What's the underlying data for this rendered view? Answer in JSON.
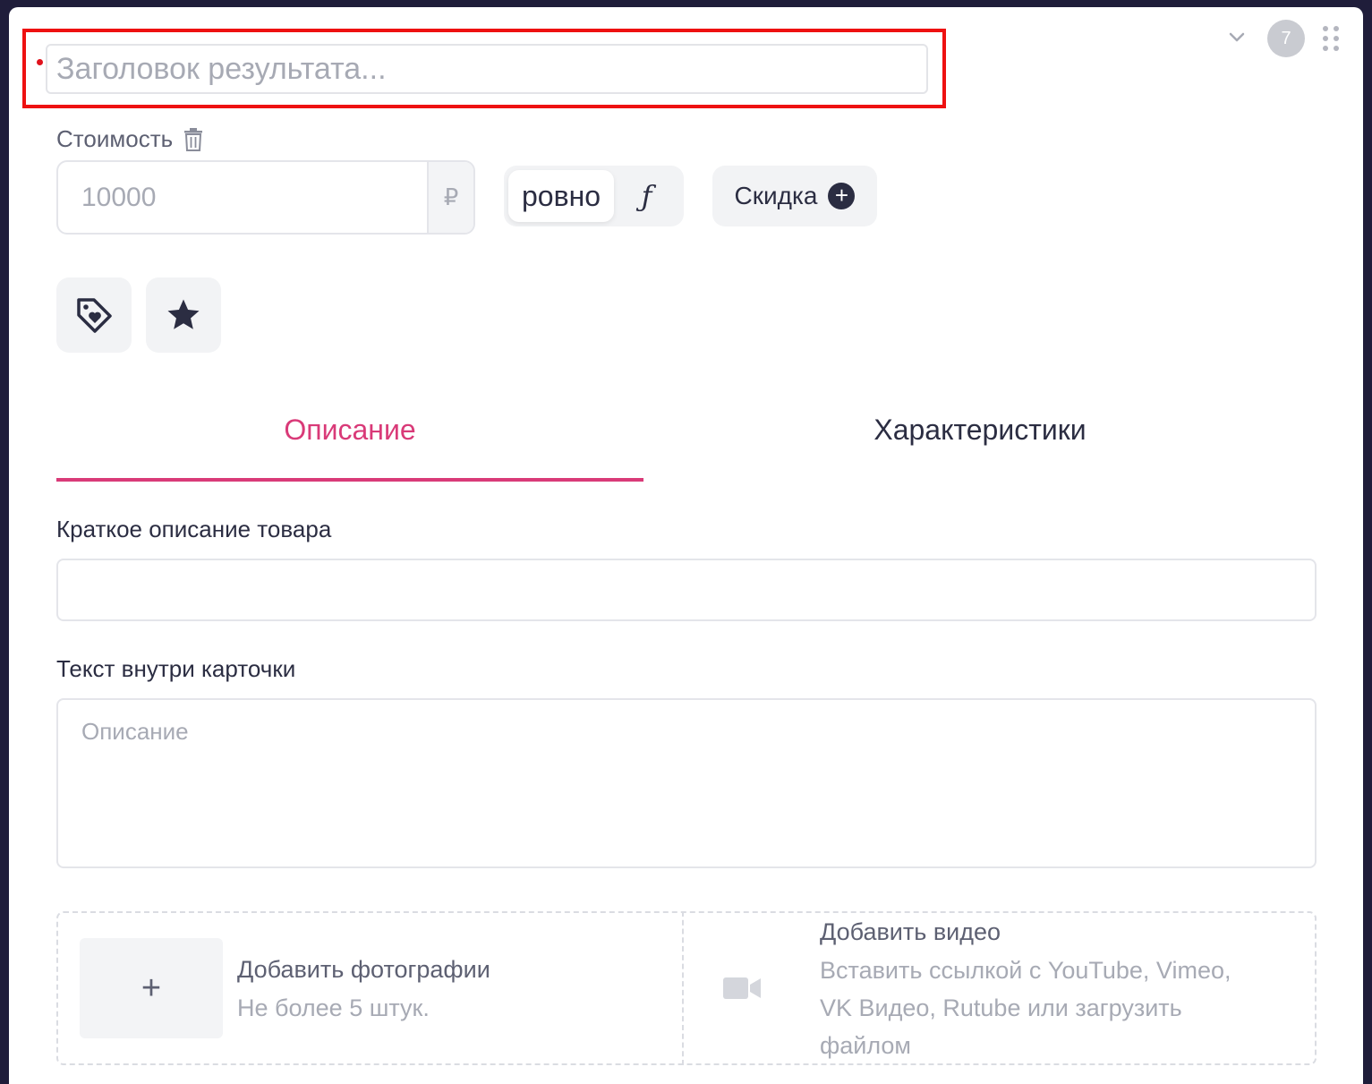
{
  "header": {
    "title_placeholder": "Заголовок результата...",
    "badge_number": "7"
  },
  "price": {
    "label": "Стоимость",
    "placeholder": "10000",
    "currency": "₽",
    "mode_exact": "ровно",
    "mode_formula": "ƒ",
    "discount_label": "Скидка"
  },
  "tabs": [
    {
      "label": "Описание",
      "active": true
    },
    {
      "label": "Характеристики",
      "active": false
    }
  ],
  "fields": {
    "short_desc_label": "Краткое описание товара",
    "card_text_label": "Текст внутри карточки",
    "card_text_placeholder": "Описание"
  },
  "media": {
    "photo_plus": "+",
    "photo_title": "Добавить фотографии",
    "photo_sub": "Не более 5 штук.",
    "video_title": "Добавить видео",
    "video_sub_1": "Вставить ссылкой с YouTube, Vimeo,",
    "video_sub_2": "VK Видео, Rutube или загрузить",
    "video_sub_3": "файлом"
  },
  "colors": {
    "accent": "#d93a78",
    "highlight": "#ee1111",
    "text": "#2b2d42"
  }
}
